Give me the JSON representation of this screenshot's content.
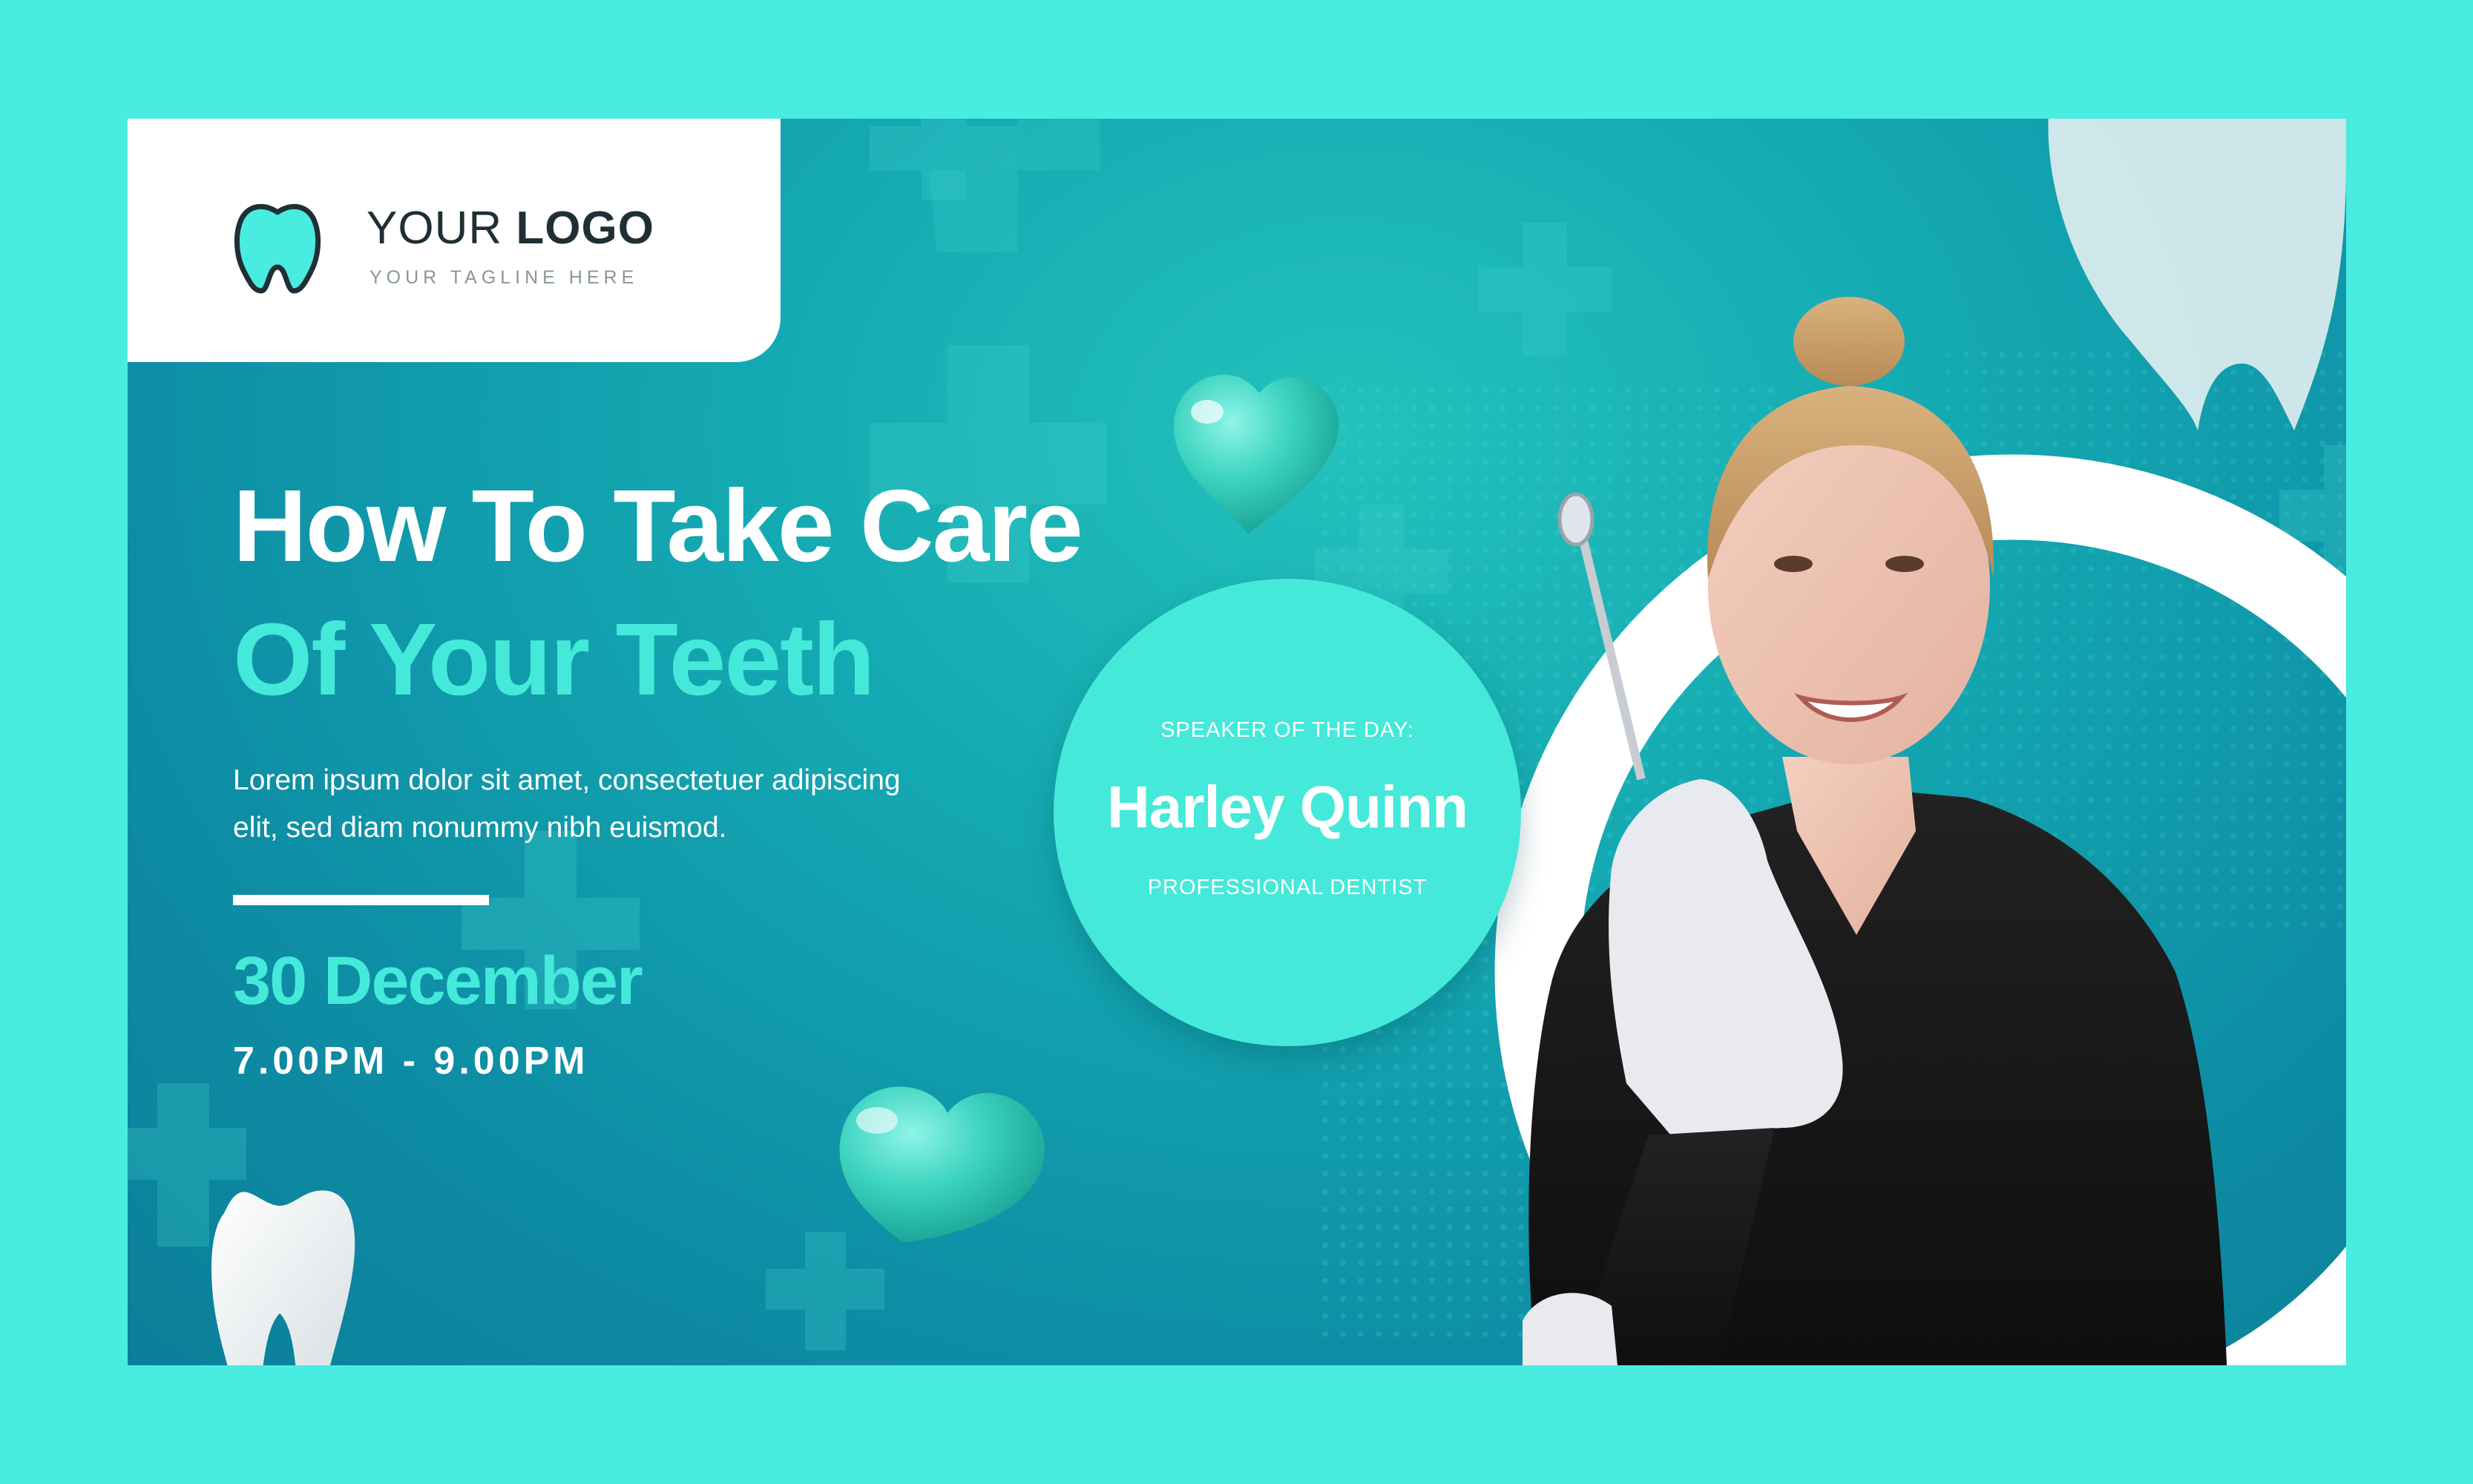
{
  "logo": {
    "title_regular": "YOUR",
    "title_bold": "LOGO",
    "tagline": "YOUR TAGLINE HERE",
    "icon": "tooth-icon"
  },
  "headline": {
    "line1": "How To Take Care",
    "line2": "Of Your Teeth"
  },
  "body": {
    "line1": "Lorem ipsum dolor sit amet, consectetuer adipiscing",
    "line2": "elit, sed diam nonummy nibh euismod."
  },
  "event": {
    "date": "30 December",
    "time": "7.00PM - 9.00PM"
  },
  "speaker": {
    "label": "SPEAKER OF THE DAY:",
    "name": "Harley Quinn",
    "role": "PROFESSIONAL DENTIST"
  },
  "colors": {
    "frame": "#49ece0",
    "accent": "#44e9da",
    "background_dark": "#0b7f99",
    "background_light": "#23c2bc"
  },
  "decorations": [
    "plus-icon",
    "heart-icon",
    "tooth-icon",
    "dentist-photo"
  ]
}
